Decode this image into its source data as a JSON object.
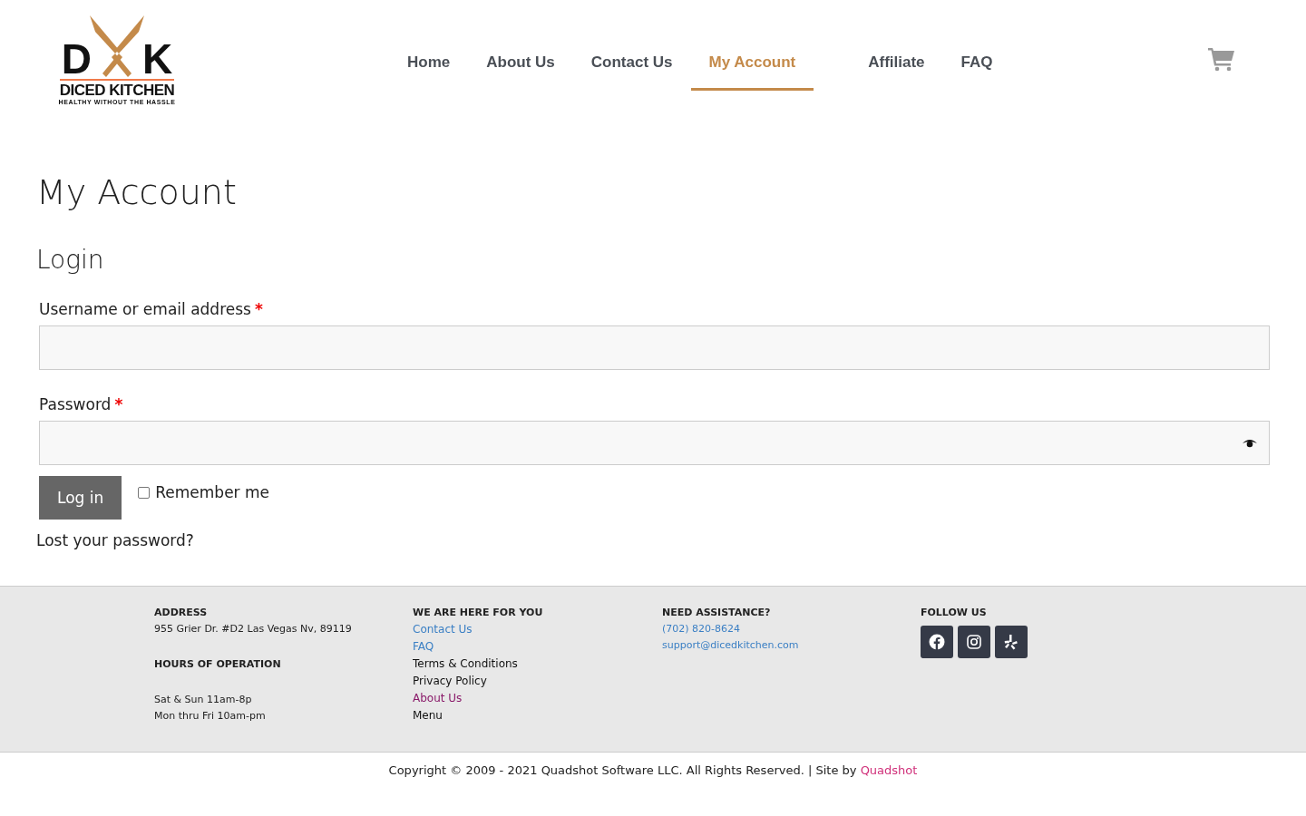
{
  "logo": {
    "letter_left": "D",
    "letter_right": "K",
    "name": "DICED KITCHEN",
    "tagline": "HEALTHY WITHOUT THE HASSLE"
  },
  "nav": [
    {
      "label": "Home",
      "selected": false
    },
    {
      "label": "About Us",
      "selected": false
    },
    {
      "label": "Contact Us",
      "selected": false
    },
    {
      "label": "My Account",
      "selected": true
    },
    {
      "label": "Affiliate",
      "selected": false
    },
    {
      "label": "FAQ",
      "selected": false
    }
  ],
  "page_title": "My Account",
  "login": {
    "heading": "Login",
    "username_label": "Username or email address",
    "password_label": "Password",
    "required_mark": "*",
    "button": "Log in",
    "remember_label": "Remember me",
    "remember_checked": false,
    "lost_password": "Lost your password?"
  },
  "footer": {
    "address": {
      "heading": "ADDRESS",
      "text": "955 Grier Dr. #D2 Las Vegas Nv, 89119",
      "hours_heading": "HOURS OF OPERATION",
      "hours": [
        "Sat & Sun 11am-8p",
        "Mon thru Fri 10am-pm"
      ]
    },
    "links": {
      "heading": "WE ARE HERE FOR YOU",
      "items": [
        {
          "label": "Contact Us",
          "color": "#3a7fc4"
        },
        {
          "label": "FAQ",
          "color": "#3a7fc4"
        },
        {
          "label": "Terms & Conditions",
          "color": "#111111"
        },
        {
          "label": "Privacy Policy",
          "color": "#111111"
        },
        {
          "label": "About Us",
          "color": "#8a1a6a"
        },
        {
          "label": "Menu",
          "color": "#111111"
        }
      ]
    },
    "assistance": {
      "heading": "NEED ASSISTANCE?",
      "phone": "(702) 820-8624",
      "email": "support@dicedkitchen.com"
    },
    "follow": {
      "heading": "FOLLOW US",
      "icons": [
        {
          "kind": "facebook"
        },
        {
          "kind": "instagram"
        },
        {
          "kind": "yelp"
        }
      ]
    }
  },
  "copyright": {
    "text": "Copyright © 2009 - 2021 Quadshot Software LLC. All Rights Reserved. | Site by ",
    "link": "Quadshot"
  }
}
